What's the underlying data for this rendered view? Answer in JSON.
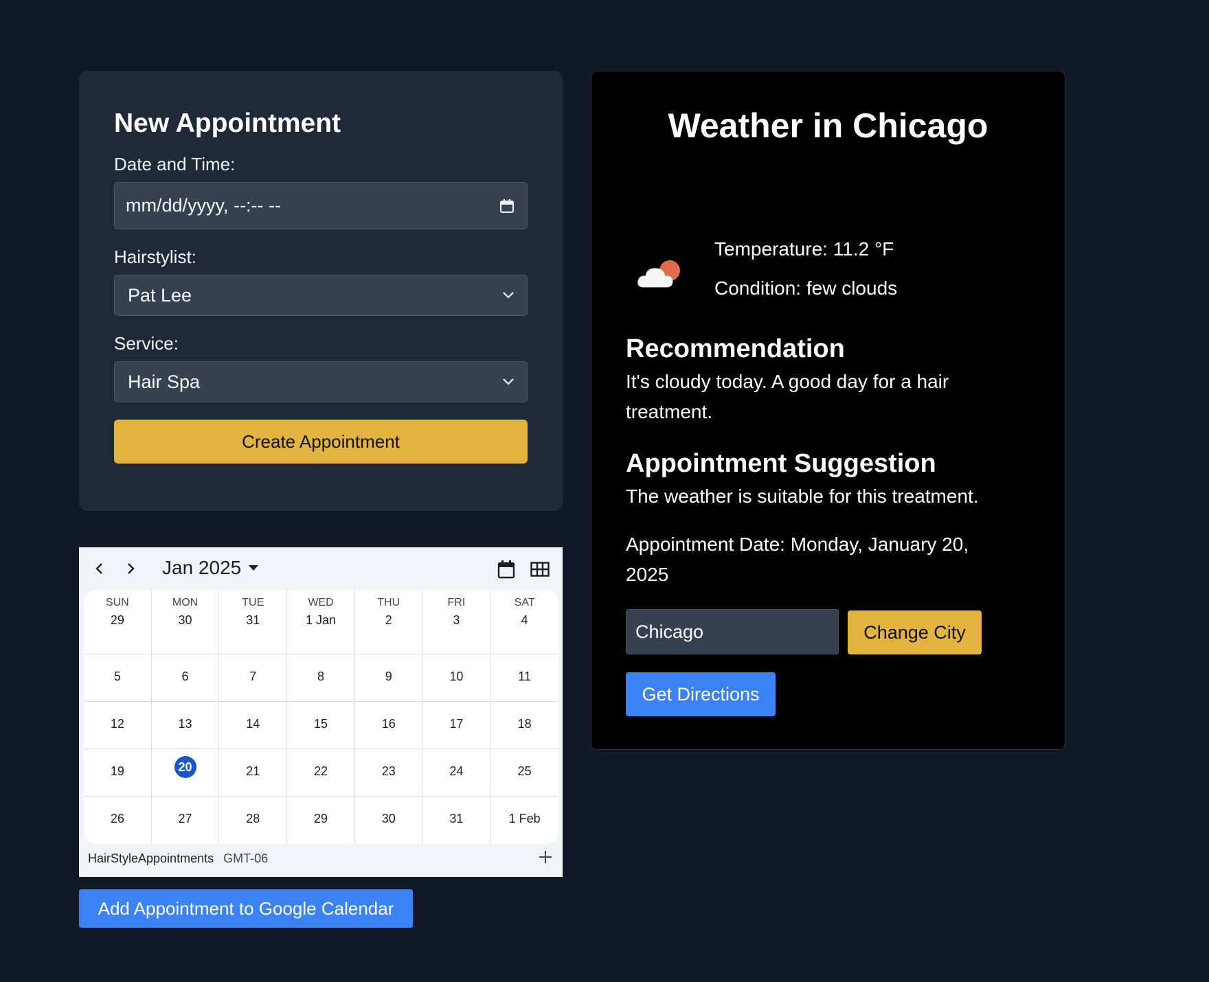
{
  "form": {
    "title": "New Appointment",
    "datetime_label": "Date and Time:",
    "datetime_placeholder": "mm/dd/yyyy, --:-- --",
    "stylist_label": "Hairstylist:",
    "stylist_value": "Pat Lee",
    "service_label": "Service:",
    "service_value": "Hair Spa",
    "submit_label": "Create Appointment"
  },
  "calendar": {
    "month": "Jan 2025",
    "header": [
      {
        "dow": "SUN",
        "num": "29"
      },
      {
        "dow": "MON",
        "num": "30"
      },
      {
        "dow": "TUE",
        "num": "31"
      },
      {
        "dow": "WED",
        "num": "1 Jan"
      },
      {
        "dow": "THU",
        "num": "2"
      },
      {
        "dow": "FRI",
        "num": "3"
      },
      {
        "dow": "SAT",
        "num": "4"
      }
    ],
    "weeks": [
      [
        "5",
        "6",
        "7",
        "8",
        "9",
        "10",
        "11"
      ],
      [
        "12",
        "13",
        "14",
        "15",
        "16",
        "17",
        "18"
      ],
      [
        "19",
        "20",
        "21",
        "22",
        "23",
        "24",
        "25"
      ],
      [
        "26",
        "27",
        "28",
        "29",
        "30",
        "31",
        "1 Feb"
      ]
    ],
    "today": "20",
    "calendar_name": "HairStyleAppointments",
    "timezone": "GMT-06"
  },
  "gcal_button": "Add Appointment to Google Calendar",
  "weather": {
    "title": "Weather in Chicago",
    "temperature": "Temperature: 11.2 °F",
    "condition": "Condition: few clouds",
    "icon": "few-clouds-icon",
    "recommendation_title": "Recommendation",
    "recommendation_text": "It's cloudy today. A good day for a hair treatment.",
    "suggestion_title": "Appointment Suggestion",
    "suggestion_text": "The weather is suitable for this treatment.",
    "appointment_date": "Appointment Date: Monday, January 20, 2025",
    "city_value": "Chicago",
    "change_city_label": "Change City",
    "directions_label": "Get Directions"
  },
  "colors": {
    "background": "#111827",
    "card": "#1f2937",
    "accent_yellow": "#e2b33e",
    "accent_blue": "#3b82f6",
    "today_blue": "#1a56c8"
  }
}
